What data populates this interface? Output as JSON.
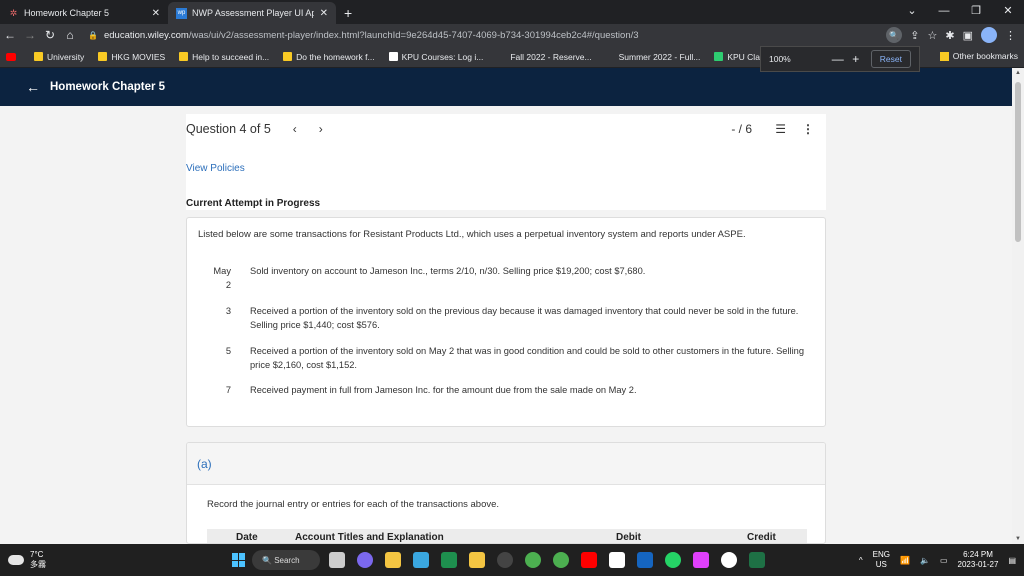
{
  "browser": {
    "tabs": [
      {
        "title": "Homework Chapter 5",
        "active": false
      },
      {
        "title": "NWP Assessment Player UI Appl",
        "active": true
      }
    ],
    "url_host": "education.wiley.com",
    "url_path": "/was/ui/v2/assessment-player/index.html?launchId=9e264d45-7407-4069-b734-301994ceb2c4#/question/3",
    "bookmarks": [
      "University",
      "HKG MOVIES",
      "Help to succeed in...",
      "Do the homework f...",
      "KPU Courses: Log i...",
      "Fall 2022 - Reserve...",
      "Summer 2022 - Full...",
      "KPU Classmate.xlsx..."
    ],
    "other_bookmarks": "Other bookmarks",
    "zoom": {
      "level": "100%",
      "minus": "—",
      "plus": "+",
      "reset": "Reset"
    }
  },
  "app": {
    "back_icon": "←",
    "title": "Homework Chapter 5"
  },
  "question": {
    "counter": "Question 4 of 5",
    "prev": "‹",
    "next": "›",
    "score": "- / 6",
    "list_icon": "☰",
    "more_icon": "⋮",
    "policies": "View Policies",
    "attempt": "Current Attempt in Progress",
    "intro": "Listed below are some transactions for Resistant Products Ltd., which uses a perpetual inventory system and reports under ASPE.",
    "transactions": [
      {
        "month": "May",
        "day": "2",
        "desc": "Sold inventory on account to Jameson Inc., terms 2/10, n/30. Selling price $19,200; cost $7,680."
      },
      {
        "day": "3",
        "desc": "Received a portion of the inventory sold on the previous day because it was damaged inventory that could never be sold in the future. Selling price $1,440; cost $576."
      },
      {
        "day": "5",
        "desc": "Received a portion of the inventory sold on May 2 that was in good condition and could be sold to other customers in the future. Selling price $2,160, cost $1,152."
      },
      {
        "day": "7",
        "desc": "Received payment in full from Jameson Inc. for the amount due from the sale made on May 2."
      }
    ]
  },
  "part_a": {
    "label": "(a)",
    "instruction": "Record the journal entry or entries for each of the transactions above.",
    "headers": {
      "date": "Date",
      "account": "Account Titles and Explanation",
      "debit": "Debit",
      "credit": "Credit"
    }
  },
  "taskbar": {
    "weather_temp": "7°C",
    "weather_desc": "多霧",
    "search": "Search",
    "lang": "ENG",
    "region": "US",
    "time": "6:24 PM",
    "date": "2023-01-27"
  }
}
